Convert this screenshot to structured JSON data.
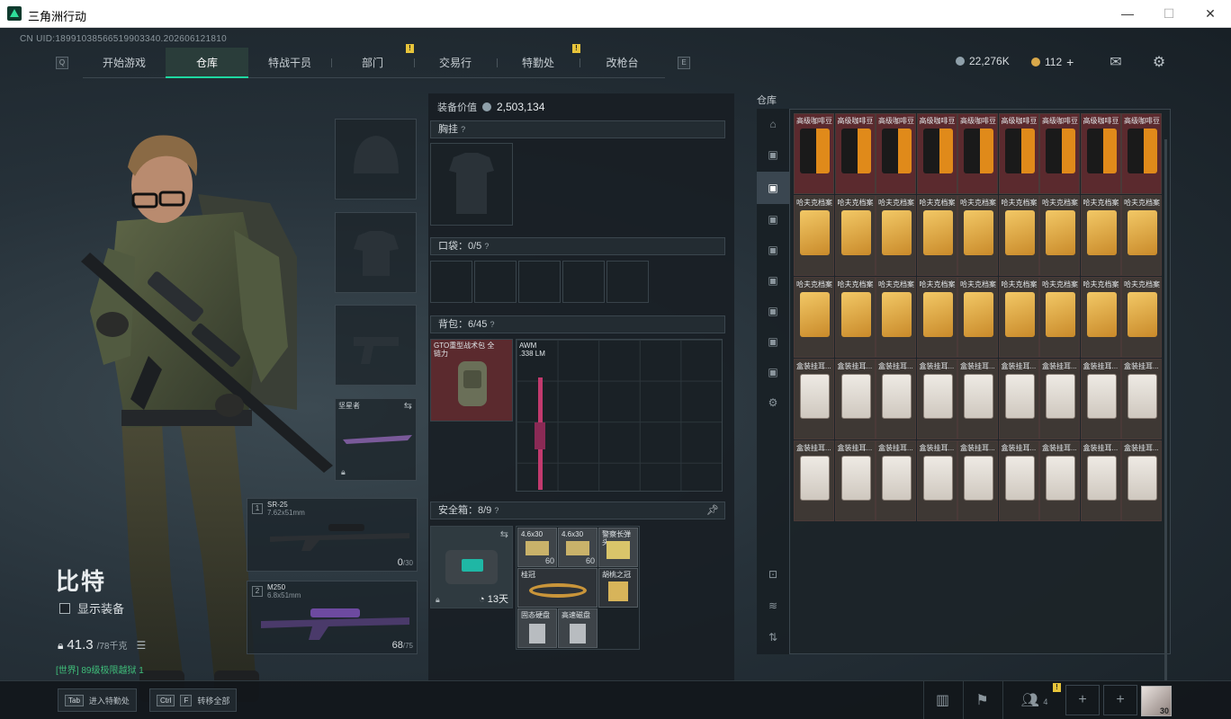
{
  "window": {
    "title": "三角洲行动",
    "min": "—",
    "max": "☐",
    "close": "✕"
  },
  "uid": "CN UID:18991038566519903340.202606121810",
  "nav": {
    "left_key": "Q",
    "right_key": "E",
    "tabs": [
      "开始游戏",
      "仓库",
      "特战干员",
      "部门",
      "交易行",
      "特勤处",
      "改枪台"
    ],
    "active": "仓库",
    "badge": "!"
  },
  "currency": {
    "hafcoin": "22,276K",
    "bonds": "112",
    "plus": "+"
  },
  "icons": {
    "mail": "mail-icon",
    "settings": "gear-icon"
  },
  "character": {
    "name": "比特",
    "show_equipment": "显示装备",
    "weight": "41.3",
    "weight_max": "/78千克",
    "chat": "[世界] 89级极限越狱 1"
  },
  "gear": {
    "melee_label": "坚星者",
    "weapon1": {
      "num": "1",
      "name": "SR-25",
      "caliber": "7.62x51mm",
      "ammo": "0",
      "ammo_max": "/30"
    },
    "weapon2": {
      "num": "2",
      "name": "M250",
      "caliber": "6.8x51mm",
      "ammo": "68",
      "ammo_max": "/75"
    }
  },
  "loadout": {
    "value_label": "装备价值",
    "value": "2,503,134",
    "chest_rig": "胸挂",
    "pockets": "口袋：",
    "pockets_count": "0/5",
    "backpack": "背包：",
    "backpack_count": "6/45",
    "backpack_item": "GTO重型战术包 全链力",
    "rifle_name": "AWM",
    "rifle_ammo": ".338 LM",
    "safe_box": "安全箱：",
    "safe_count": "8/9",
    "safe_days": "13天",
    "help": "?",
    "safe_items": [
      {
        "label": "4.6x30",
        "qty": "60"
      },
      {
        "label": "4.6x30",
        "qty": "60"
      },
      {
        "label": "警察长弹头",
        "qty": ""
      },
      {
        "label": "桂冠",
        "qty": ""
      },
      {
        "label": "胡桃之冠",
        "qty": ""
      },
      {
        "label": "固态硬盘",
        "qty": ""
      },
      {
        "label": "高速磁盘",
        "qty": ""
      }
    ]
  },
  "storage": {
    "title": "仓库",
    "rows": [
      {
        "label": "高级咖啡豆",
        "color": "#5b2a2e"
      },
      {
        "label": "哈夫克档案",
        "color": "#3e3834"
      },
      {
        "label": "哈夫克档案",
        "color": "#3e3834"
      },
      {
        "label": "盒装挂耳...",
        "color": "#3e3834"
      },
      {
        "label": "盒装挂耳...",
        "color": "#3e3834"
      }
    ],
    "per_row": 9
  },
  "bottom": {
    "hint1_key": "Tab",
    "hint1": "进入特勤处",
    "hint2_key": "Ctrl",
    "hint2_key2": "F",
    "hint2": "转移全部",
    "friends_count": "4",
    "avatar_level": "30"
  }
}
